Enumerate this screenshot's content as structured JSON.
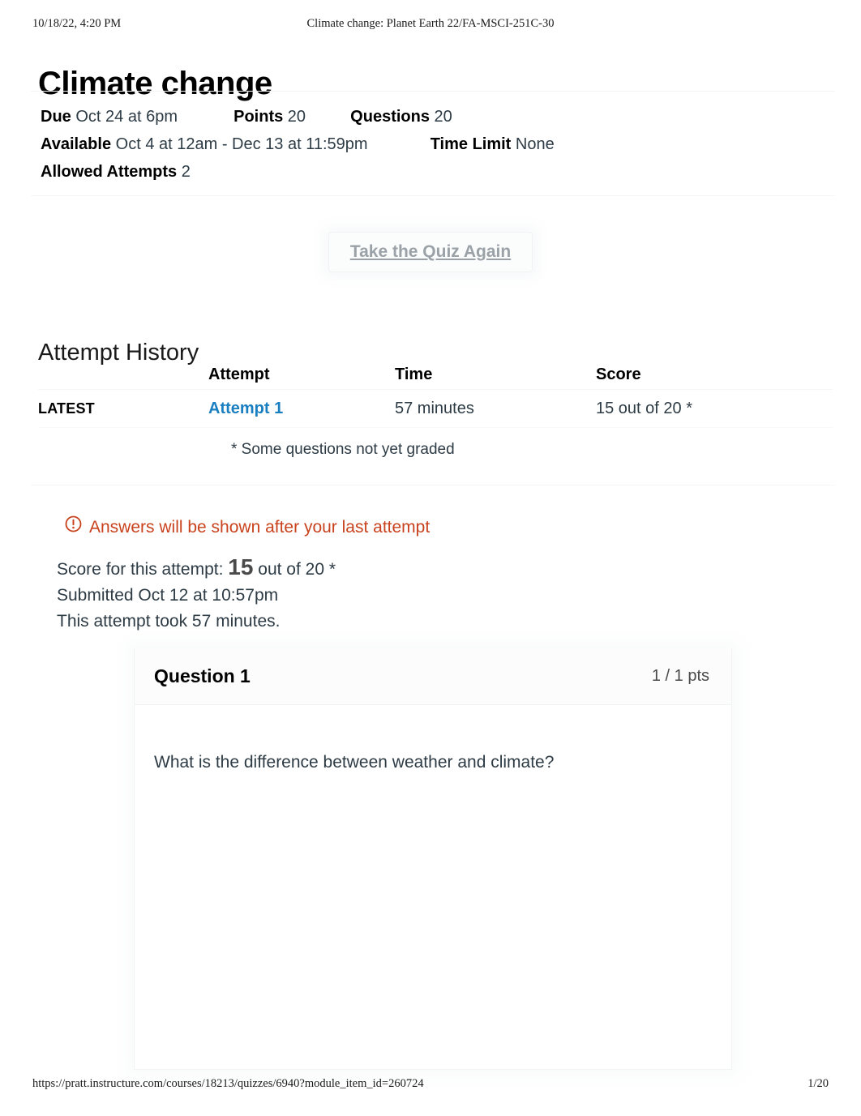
{
  "print": {
    "timestamp": "10/18/22, 4:20 PM",
    "doc_title": "Climate change: Planet Earth 22/FA-MSCI-251C-30",
    "url": "https://pratt.instructure.com/courses/18213/quizzes/6940?module_item_id=260724",
    "page_number": "1/20"
  },
  "quiz": {
    "title": "Climate change",
    "meta": {
      "due_label": "Due",
      "due_value": "Oct 24 at 6pm",
      "points_label": "Points",
      "points_value": "20",
      "questions_label": "Questions",
      "questions_value": "20",
      "available_label": "Available",
      "available_value": "Oct 4 at 12am - Dec 13 at 11:59pm",
      "time_limit_label": "Time Limit",
      "time_limit_value": "None",
      "allowed_attempts_label": "Allowed Attempts",
      "allowed_attempts_value": "2"
    },
    "retake_button_label": "Take the Quiz Again"
  },
  "attempt_history": {
    "heading": "Attempt History",
    "columns": [
      "",
      "Attempt",
      "Time",
      "Score"
    ],
    "rows": [
      {
        "flag": "LATEST",
        "attempt": "Attempt 1",
        "time": "57 minutes",
        "score": "15 out of 20 *"
      }
    ],
    "note": "* Some questions not yet graded"
  },
  "warning": {
    "icon": "exclamation-circle-icon",
    "text": "Answers will be shown after your last attempt",
    "color": "#c9421e"
  },
  "attempt_summary": {
    "score_prefix": "Score for this attempt:",
    "score_value": "15",
    "score_suffix": "out of 20 *",
    "submitted": "Submitted Oct 12 at 10:57pm",
    "duration": "This attempt took 57 minutes."
  },
  "question": {
    "name": "Question 1",
    "points": "1 / 1 pts",
    "text": "What is the difference between weather and climate?"
  },
  "colors": {
    "link_blue": "#1a7fc1",
    "warning_orange": "#c9421e",
    "text": "#2d3b45"
  }
}
